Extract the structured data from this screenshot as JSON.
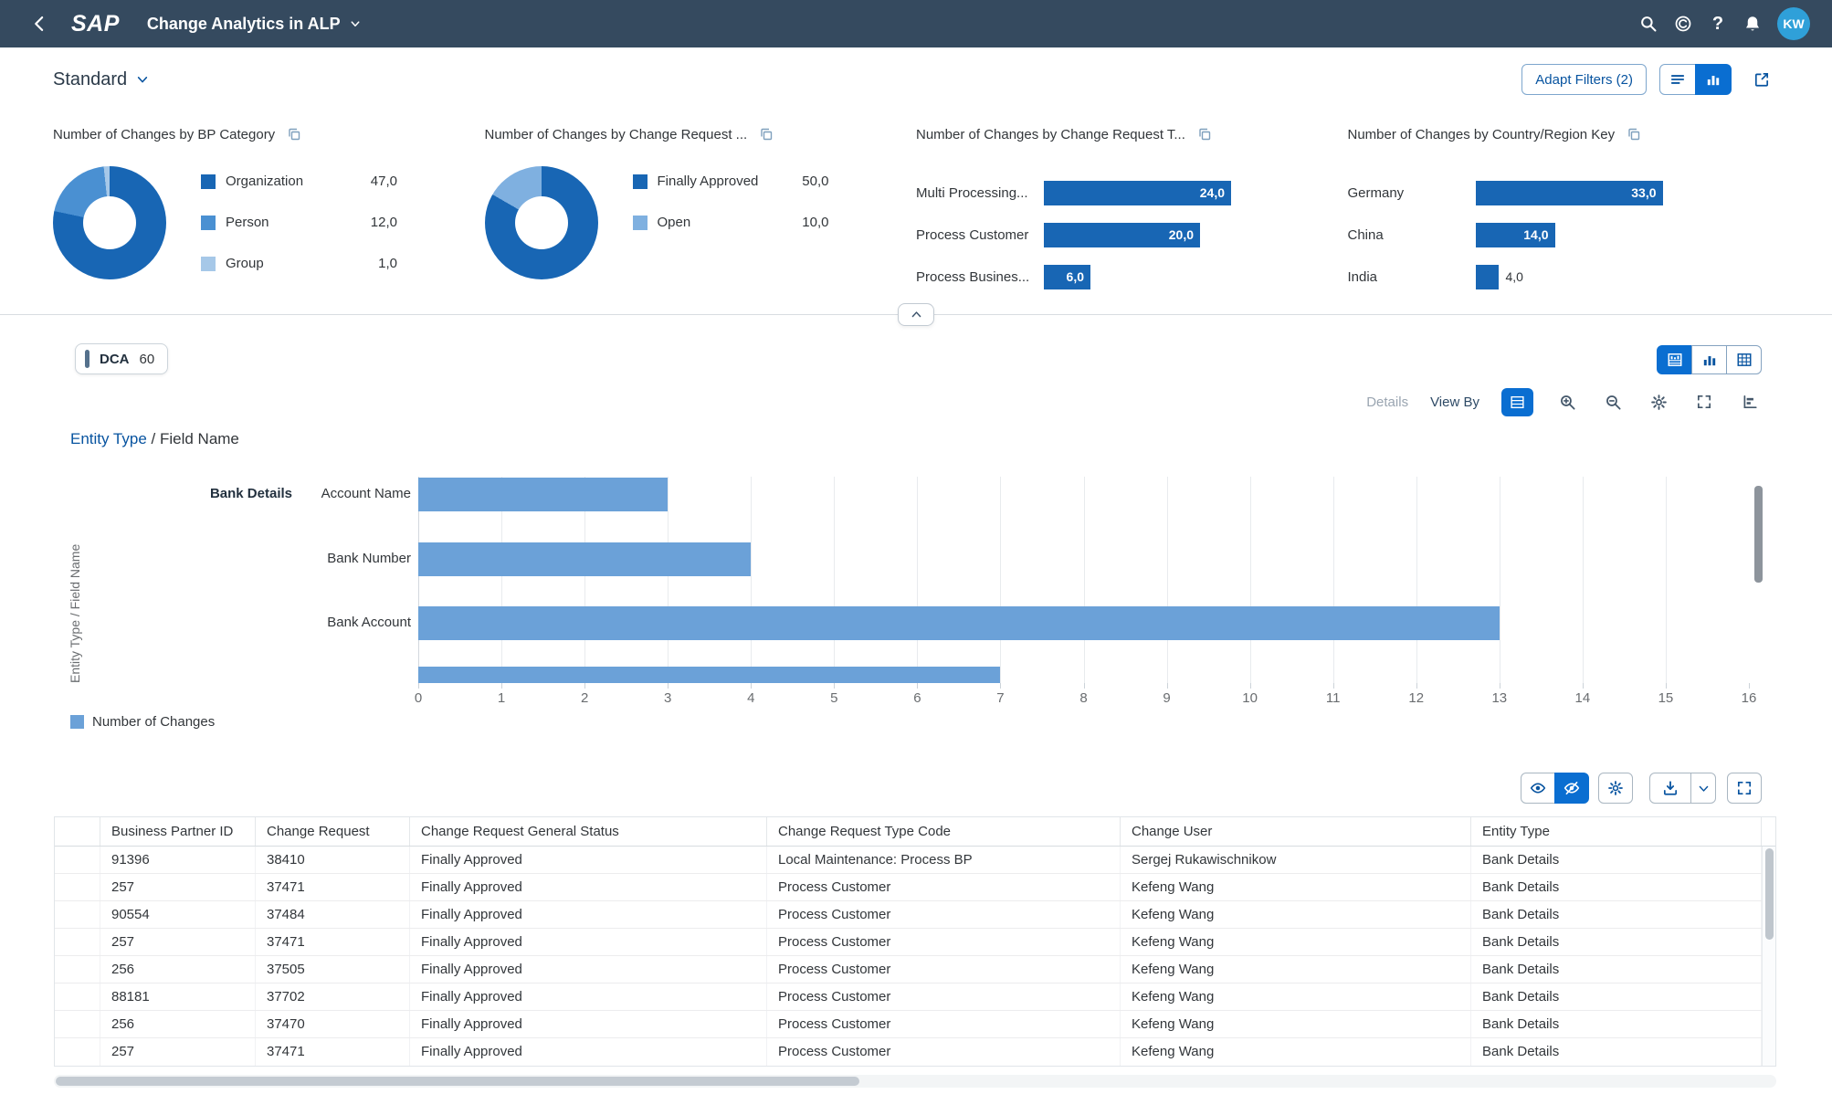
{
  "shell": {
    "logo_text": "SAP",
    "title": "Change Analytics in ALP",
    "help_glyph": "?",
    "avatar_initials": "KW"
  },
  "filter_bar": {
    "variant_title": "Standard",
    "adapt_filters_label": "Adapt Filters (2)"
  },
  "colors": {
    "accent_blue": "#0a6ed1",
    "link_blue": "#0854a0",
    "kpi_dark_blue": "#1866b4",
    "main_bar_blue": "#6ba1d8",
    "shell_bg": "#354a5f"
  },
  "kpi_cards": [
    {
      "title": "Number of Changes by BP Category",
      "type": "donut",
      "items": [
        {
          "label": "Organization",
          "value": "47,0",
          "num": 47,
          "color": "#1866b4"
        },
        {
          "label": "Person",
          "value": "12,0",
          "num": 12,
          "color": "#4a90d2"
        },
        {
          "label": "Group",
          "value": "1,0",
          "num": 1,
          "color": "#a6c8e8"
        }
      ]
    },
    {
      "title": "Number of Changes by Change Request ...",
      "type": "donut",
      "items": [
        {
          "label": "Finally Approved",
          "value": "50,0",
          "num": 50,
          "color": "#1866b4"
        },
        {
          "label": "Open",
          "value": "10,0",
          "num": 10,
          "color": "#7fb0e0"
        }
      ]
    },
    {
      "title": "Number of Changes by Change Request T...",
      "type": "bar",
      "items": [
        {
          "label": "Multi Processing...",
          "value": "24,0",
          "num": 24
        },
        {
          "label": "Process Customer",
          "value": "20,0",
          "num": 20
        },
        {
          "label": "Process Busines...",
          "value": "6,0",
          "num": 6
        }
      ]
    },
    {
      "title": "Number of Changes by Country/Region Key",
      "type": "bar",
      "items": [
        {
          "label": "Germany",
          "value": "33,0",
          "num": 33
        },
        {
          "label": "China",
          "value": "14,0",
          "num": 14
        },
        {
          "label": "India",
          "value": "4,0",
          "num": 4
        }
      ]
    }
  ],
  "chart_panel": {
    "chip_label": "DCA",
    "chip_count": "60",
    "details_label": "Details",
    "view_by_label": "View By",
    "breadcrumb_link": "Entity Type",
    "breadcrumb_rest": " / Field Name",
    "axis_title": "Entity Type / Field Name",
    "legend_label": "Number of Changes"
  },
  "chart_data": {
    "type": "bar",
    "orientation": "horizontal",
    "group_label": "Bank Details",
    "categories": [
      "Account Name",
      "Bank Number",
      "Bank Account",
      ""
    ],
    "values": [
      3,
      4,
      13,
      7
    ],
    "series_name": "Number of Changes",
    "x_ticks": [
      0,
      1,
      2,
      3,
      4,
      5,
      6,
      7,
      8,
      9,
      10,
      11,
      12,
      13,
      14,
      15,
      16
    ],
    "xlim": [
      0,
      16
    ],
    "grid": true,
    "legend_position": "bottom"
  },
  "table": {
    "columns": [
      "Business Partner ID",
      "Change Request",
      "Change Request General Status",
      "Change Request Type Code",
      "Change User",
      "Entity Type"
    ],
    "rows": [
      [
        "91396",
        "38410",
        "Finally Approved",
        "Local Maintenance: Process BP",
        "Sergej Rukawischnikow",
        "Bank Details"
      ],
      [
        "257",
        "37471",
        "Finally Approved",
        "Process Customer",
        "Kefeng Wang",
        "Bank Details"
      ],
      [
        "90554",
        "37484",
        "Finally Approved",
        "Process Customer",
        "Kefeng Wang",
        "Bank Details"
      ],
      [
        "257",
        "37471",
        "Finally Approved",
        "Process Customer",
        "Kefeng Wang",
        "Bank Details"
      ],
      [
        "256",
        "37505",
        "Finally Approved",
        "Process Customer",
        "Kefeng Wang",
        "Bank Details"
      ],
      [
        "88181",
        "37702",
        "Finally Approved",
        "Process Customer",
        "Kefeng Wang",
        "Bank Details"
      ],
      [
        "256",
        "37470",
        "Finally Approved",
        "Process Customer",
        "Kefeng Wang",
        "Bank Details"
      ],
      [
        "257",
        "37471",
        "Finally Approved",
        "Process Customer",
        "Kefeng Wang",
        "Bank Details"
      ]
    ]
  }
}
